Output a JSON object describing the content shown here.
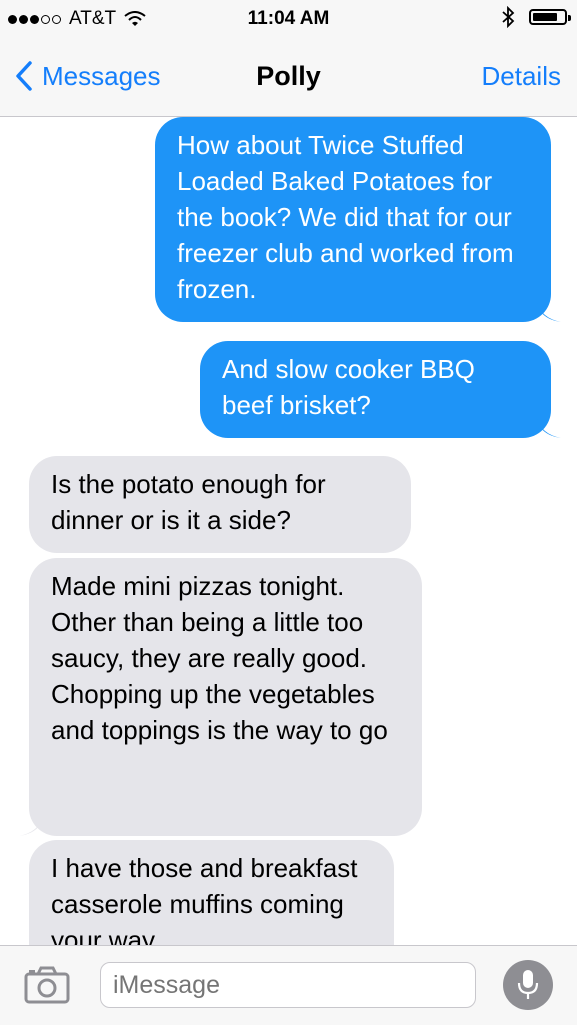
{
  "status": {
    "carrier": "AT&T",
    "time": "11:04 AM",
    "signal_bars": 3,
    "signal_total": 5
  },
  "nav": {
    "back_label": "Messages",
    "title": "Polly",
    "details_label": "Details"
  },
  "messages": [
    {
      "from": "me",
      "text": "How about Twice Stuffed Loaded Baked Potatoes for the book? We did that for our freezer club and worked from frozen."
    },
    {
      "from": "me",
      "text": "And slow cooker BBQ beef brisket?"
    },
    {
      "from": "them",
      "text": "Is the potato enough for dinner or is it a side?"
    },
    {
      "from": "them",
      "text": "Made mini pizzas tonight. Other than being a little too saucy, they are really good. Chopping up the vegetables and toppings is the way to go"
    },
    {
      "from": "them",
      "text": "I have those and breakfast casserole muffins coming your way"
    }
  ],
  "input": {
    "placeholder": "iMessage"
  },
  "colors": {
    "sent": "#1e94f7",
    "received": "#e5e5ea",
    "accent": "#147efb"
  },
  "icons": {
    "back": "chevron-left-icon",
    "camera": "camera-icon",
    "mic": "microphone-icon",
    "bluetooth": "bluetooth-icon",
    "wifi": "wifi-icon",
    "battery": "battery-icon"
  }
}
